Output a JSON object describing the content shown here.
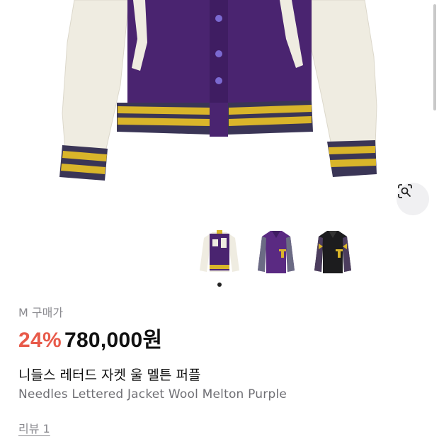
{
  "product": {
    "size_label": "M 구매가",
    "discount": "24%",
    "price": "780,000",
    "price_unit": "원",
    "title_ko": "니들스 레터드 자켓 울 멜튼 퍼플",
    "title_en": "Needles Lettered Jacket Wool Melton Purple",
    "review_link": "리뷰 1"
  },
  "gallery": {
    "thumbnails": [
      "purple-white-varsity-jacket",
      "purple-T-jacket",
      "black-T-jacket"
    ],
    "current_index": 0,
    "lens_icon": "visual-search-icon"
  },
  "colors": {
    "discount": "#e85a4a",
    "jacket_purple": "#4a2470",
    "sleeve_cream": "#efece1",
    "stripe_yellow": "#d9b52a",
    "stripe_navy": "#3a3556"
  }
}
